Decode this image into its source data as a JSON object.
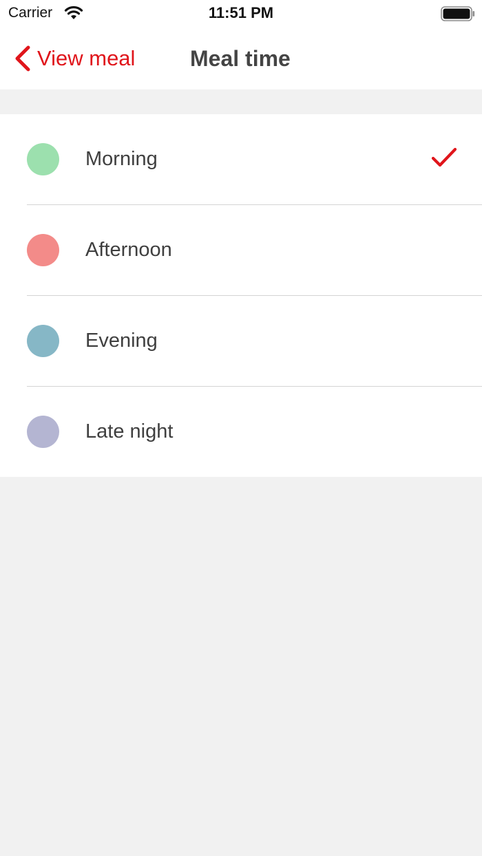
{
  "status_bar": {
    "carrier": "Carrier",
    "time": "11:51 PM",
    "wifi_icon": "wifi-icon",
    "battery_icon": "battery-icon"
  },
  "nav": {
    "back_label": "View meal",
    "back_icon": "chevron-left-icon",
    "title": "Meal time"
  },
  "colors": {
    "accent": "#e0151b",
    "background": "#f1f1f1",
    "surface": "#ffffff"
  },
  "meal_times": [
    {
      "label": "Morning",
      "color": "#9ce0ae",
      "selected": true
    },
    {
      "label": "Afternoon",
      "color": "#f38b89",
      "selected": false
    },
    {
      "label": "Evening",
      "color": "#86b7c6",
      "selected": false
    },
    {
      "label": "Late night",
      "color": "#b4b5d2",
      "selected": false
    }
  ],
  "selected_icon": "checkmark-icon"
}
